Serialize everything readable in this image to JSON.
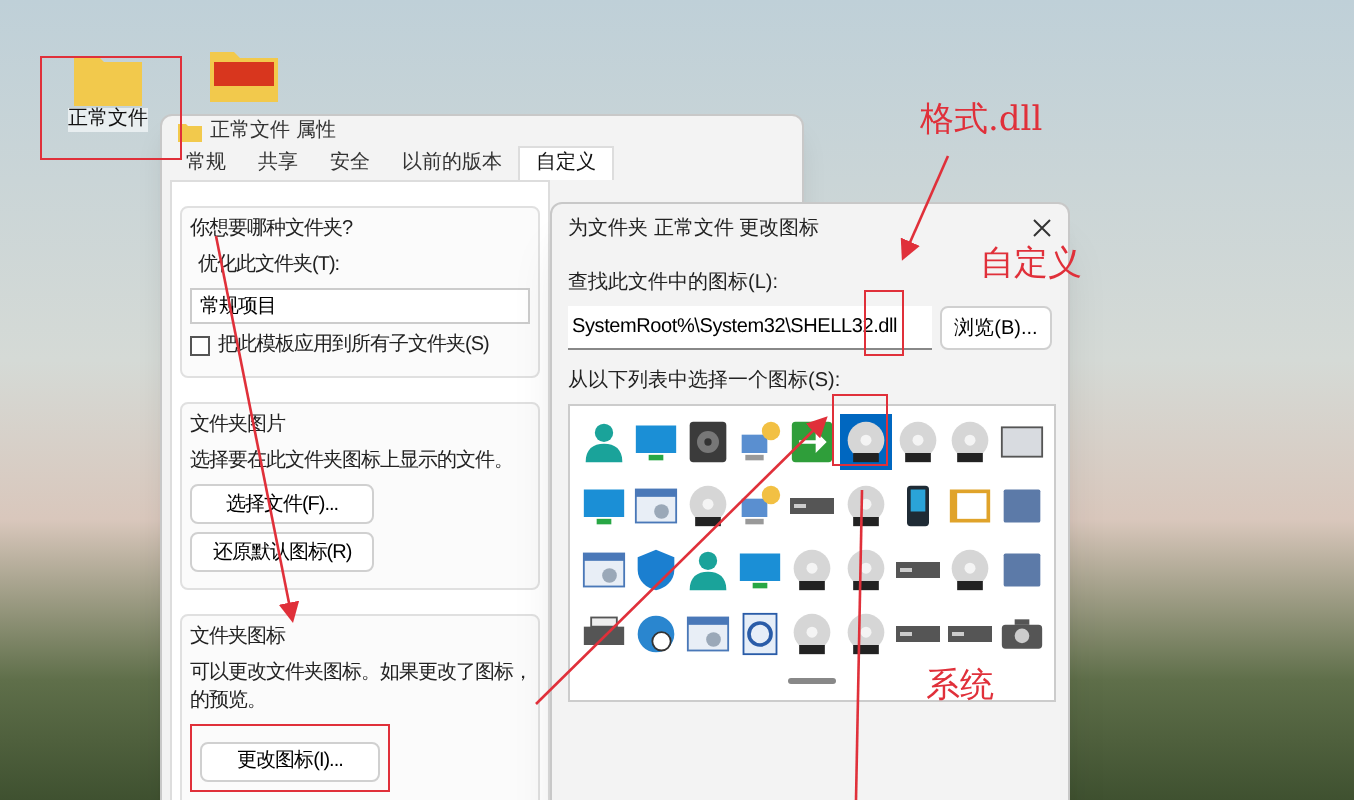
{
  "desktop": {
    "icons": [
      {
        "label": "正常文件",
        "kind": "folder"
      },
      {
        "kind": "picture-folder"
      }
    ]
  },
  "properties_window": {
    "title": "正常文件 属性",
    "tabs": [
      {
        "label": "常规",
        "selected": false
      },
      {
        "label": "共享",
        "selected": false
      },
      {
        "label": "安全",
        "selected": false
      },
      {
        "label": "以前的版本",
        "selected": false
      },
      {
        "label": "自定义",
        "selected": true
      }
    ],
    "folder_type": {
      "heading": "你想要哪种文件夹?",
      "label": "优化此文件夹(T):",
      "value": "常规项目",
      "apply_checkbox": {
        "label": "把此模板应用到所有子文件夹(S)",
        "checked": false
      }
    },
    "folder_picture": {
      "heading": "文件夹图片",
      "text": "选择要在此文件夹图标上显示的文件。",
      "buttons": [
        "选择文件(F)...",
        "还原默认图标(R)"
      ]
    },
    "folder_icon": {
      "heading": "文件夹图标",
      "text_lines": [
        "可以更改文件夹图标。如果更改了图标，",
        "的预览。"
      ],
      "button": "更改图标(I)..."
    }
  },
  "change_icon_dialog": {
    "title": "为文件夹 正常文件 更改图标",
    "file_label": "查找此文件中的图标(L):",
    "file_value": "SystemRoot%\\System32\\SHELL32.dll",
    "browse_button": "浏览(B)...",
    "list_label": "从以下列表中选择一个图标(S):",
    "icons": [
      {
        "selected": false
      },
      {
        "selected": false
      },
      {
        "selected": false
      },
      {
        "selected": false
      },
      {
        "selected": false
      },
      {
        "selected": true
      },
      {
        "selected": false
      },
      {
        "selected": false
      },
      {
        "selected": false
      },
      {
        "selected": false
      },
      {
        "selected": false
      },
      {
        "selected": false
      },
      {
        "selected": false
      },
      {
        "selected": false
      },
      {
        "selected": false
      },
      {
        "selected": false
      },
      {
        "selected": false
      },
      {
        "selected": false
      },
      {
        "selected": false
      },
      {
        "selected": false
      },
      {
        "selected": false
      },
      {
        "selected": false
      },
      {
        "selected": false
      },
      {
        "selected": false
      },
      {
        "selected": false
      },
      {
        "selected": false
      },
      {
        "selected": false
      },
      {
        "selected": false
      },
      {
        "selected": false
      },
      {
        "selected": false
      },
      {
        "selected": false
      },
      {
        "selected": false
      },
      {
        "selected": false
      },
      {
        "selected": false
      },
      {
        "selected": false
      },
      {
        "selected": false
      }
    ]
  },
  "annotations": [
    "格式.dll",
    "自定义",
    "系统"
  ]
}
